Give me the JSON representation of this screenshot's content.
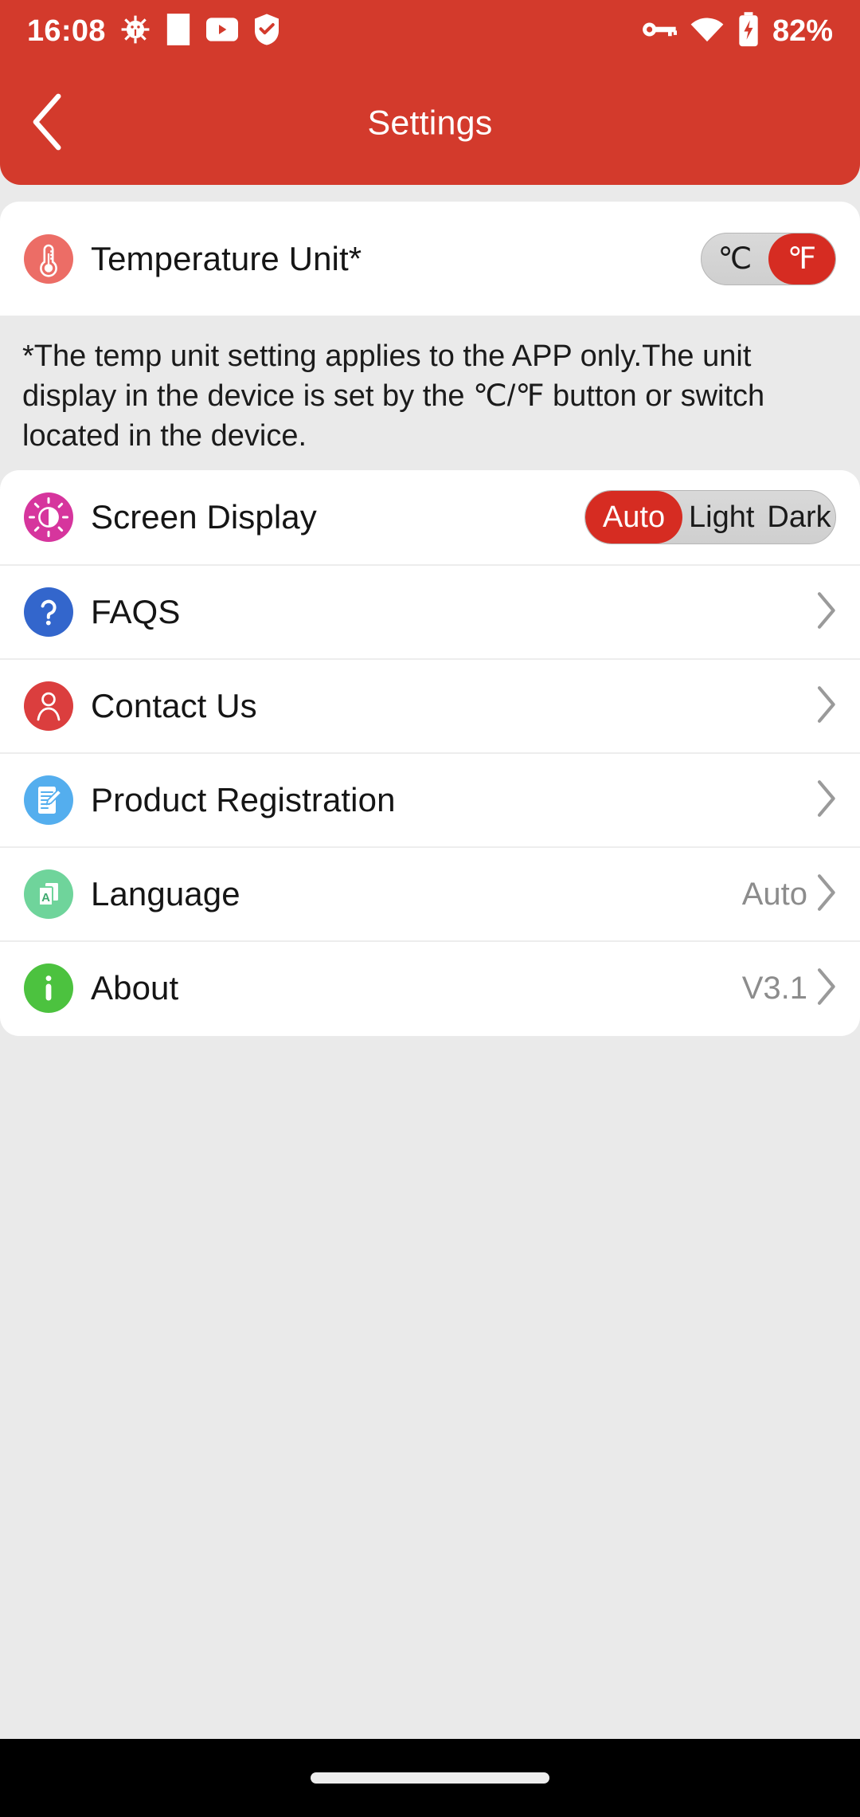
{
  "status_bar": {
    "time": "16:08",
    "battery_percent": "82%",
    "left_icons": [
      "android-debug-icon",
      "blank-notification-icon",
      "youtube-icon",
      "security-shield-icon"
    ],
    "right_icons": [
      "vpn-key-icon",
      "wifi-icon",
      "battery-charging-icon"
    ]
  },
  "app_bar": {
    "title": "Settings",
    "back_icon": "chevron-left-icon"
  },
  "temperature": {
    "label": "Temperature Unit*",
    "icon": "thermometer-icon",
    "options": [
      "℃",
      "℉"
    ],
    "selected": "℉"
  },
  "note": {
    "text": "*The temp unit setting applies to the APP only.The unit display in the device is set by the ℃/℉ button or switch located in the device."
  },
  "screen_display": {
    "label": "Screen Display",
    "icon": "brightness-contrast-icon",
    "options": [
      "Auto",
      "Light",
      "Dark"
    ],
    "selected": "Auto"
  },
  "menu_items": [
    {
      "label": "FAQS",
      "icon": "question-mark-circle-icon",
      "value": "",
      "chevron": "chevron-right-icon"
    },
    {
      "label": "Contact Us",
      "icon": "person-circle-icon",
      "value": "",
      "chevron": "chevron-right-icon"
    },
    {
      "label": "Product Registration",
      "icon": "document-pen-icon",
      "value": "",
      "chevron": "chevron-right-icon"
    },
    {
      "label": "Language",
      "icon": "translate-icon",
      "value": "Auto",
      "chevron": "chevron-right-icon"
    },
    {
      "label": "About",
      "icon": "info-circle-icon",
      "value": "V3.1",
      "chevron": "chevron-right-icon"
    }
  ],
  "colors": {
    "brand_red": "#D33A2C",
    "accent_red": "#D62C22",
    "page_bg": "#EAEAEA",
    "card_bg": "#FFFFFF",
    "thermometer_icon": "#EC6D66",
    "display_icon": "#D6359D",
    "faq_icon": "#3366CC",
    "contact_icon": "#DB3E3E",
    "registration_icon": "#54AEEE",
    "language_icon": "#6FD49B",
    "about_icon": "#4CC23F"
  },
  "nav_bar": {
    "home_indicator": "home-indicator"
  }
}
